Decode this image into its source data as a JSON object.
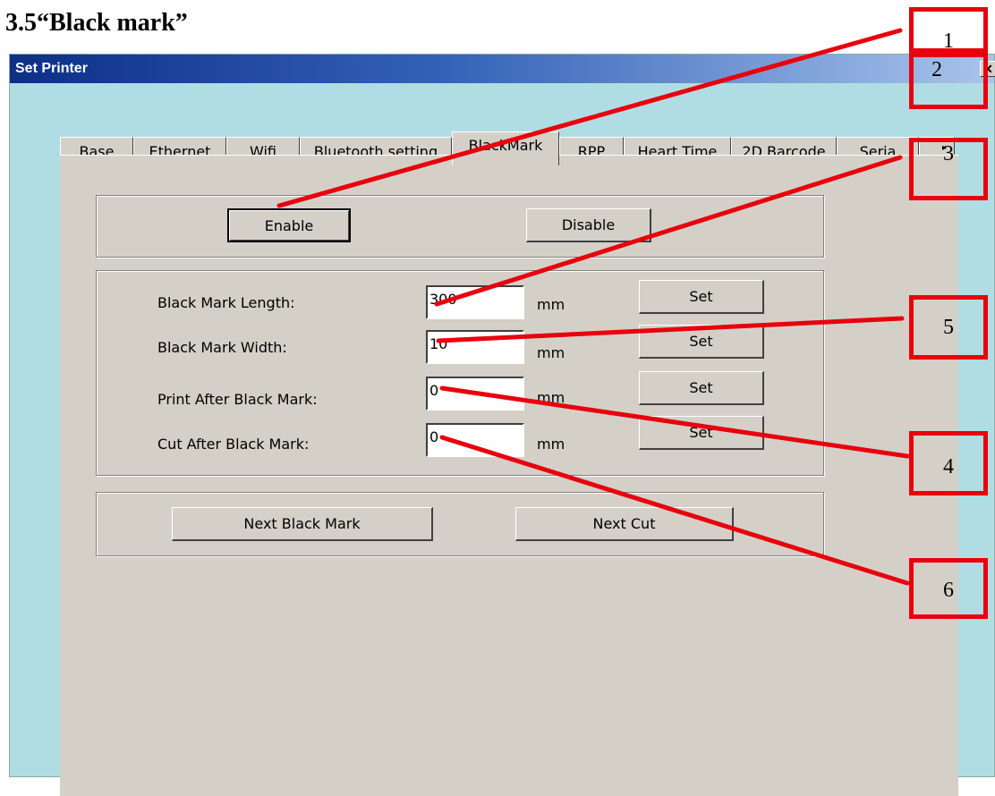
{
  "heading": "3.5“Black mark”",
  "window": {
    "title": "Set Printer",
    "close_glyph": "✕",
    "close_icon": "close-icon"
  },
  "tabs": [
    {
      "label": "Base",
      "active": false
    },
    {
      "label": "Ethernet",
      "active": false
    },
    {
      "label": "Wifi",
      "active": false
    },
    {
      "label": "Bluetooth setting",
      "active": false
    },
    {
      "label": "BlackMark",
      "active": true
    },
    {
      "label": "RPP",
      "active": false
    },
    {
      "label": "Heart Time",
      "active": false
    },
    {
      "label": "2D Barcode",
      "active": false
    },
    {
      "label": "Seria",
      "active": false
    }
  ],
  "tab_scroll": {
    "left_icon": "scroll-left-icon",
    "right_icon": "scroll-right-icon",
    "right_glyph": "▸"
  },
  "enable_group": {
    "enable_label": "Enable",
    "disable_label": "Disable"
  },
  "fields": [
    {
      "label": "Black Mark Length:",
      "value": "300",
      "unit": "mm",
      "button": "Set"
    },
    {
      "label": "Black Mark Width:",
      "value": "10",
      "unit": "mm",
      "button": "Set"
    },
    {
      "label": "Print After Black Mark:",
      "value": "0",
      "unit": "mm",
      "button": "Set"
    },
    {
      "label": "Cut After Black Mark:",
      "value": "0",
      "unit": "mm",
      "button": "Set"
    }
  ],
  "actions": {
    "next_black_mark": "Next Black Mark",
    "next_cut": "Next Cut"
  },
  "callouts": [
    "1",
    "2",
    "3",
    "5",
    "4",
    "6"
  ],
  "annotation_color": "#e8000d"
}
